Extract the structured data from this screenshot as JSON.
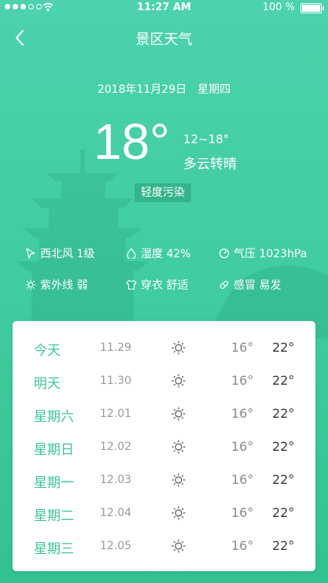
{
  "status_bar": {
    "time": "11:27 AM",
    "battery": "100 %"
  },
  "nav": {
    "title": "景区天气"
  },
  "current": {
    "date": "2018年11月29日",
    "weekday": "星期四",
    "temp": "18°",
    "range": "12~18°",
    "condition": "多云转晴",
    "air_quality": "轻度污染"
  },
  "details": {
    "wind": "西北风 1级",
    "humidity": "湿度 42%",
    "pressure": "气压 1023hPa",
    "uv": "紫外线 弱",
    "dressing": "穿衣 舒适",
    "cold": "感冒 易发"
  },
  "forecast": [
    {
      "day": "今天",
      "date": "11.29",
      "icon": "sun-icon",
      "low": "16°",
      "high": "22°"
    },
    {
      "day": "明天",
      "date": "11.30",
      "icon": "sun-icon",
      "low": "16°",
      "high": "22°"
    },
    {
      "day": "星期六",
      "date": "12.01",
      "icon": "sun-icon",
      "low": "16°",
      "high": "22°"
    },
    {
      "day": "星期日",
      "date": "12.02",
      "icon": "sun-icon",
      "low": "16°",
      "high": "22°"
    },
    {
      "day": "星期一",
      "date": "12.03",
      "icon": "sun-icon",
      "low": "16°",
      "high": "22°"
    },
    {
      "day": "星期二",
      "date": "12.04",
      "icon": "sun-icon",
      "low": "16°",
      "high": "22°"
    },
    {
      "day": "星期三",
      "date": "12.05",
      "icon": "sun-icon",
      "low": "16°",
      "high": "22°"
    }
  ],
  "colors": {
    "background": "#44cea6",
    "accent": "#3cc69a"
  }
}
